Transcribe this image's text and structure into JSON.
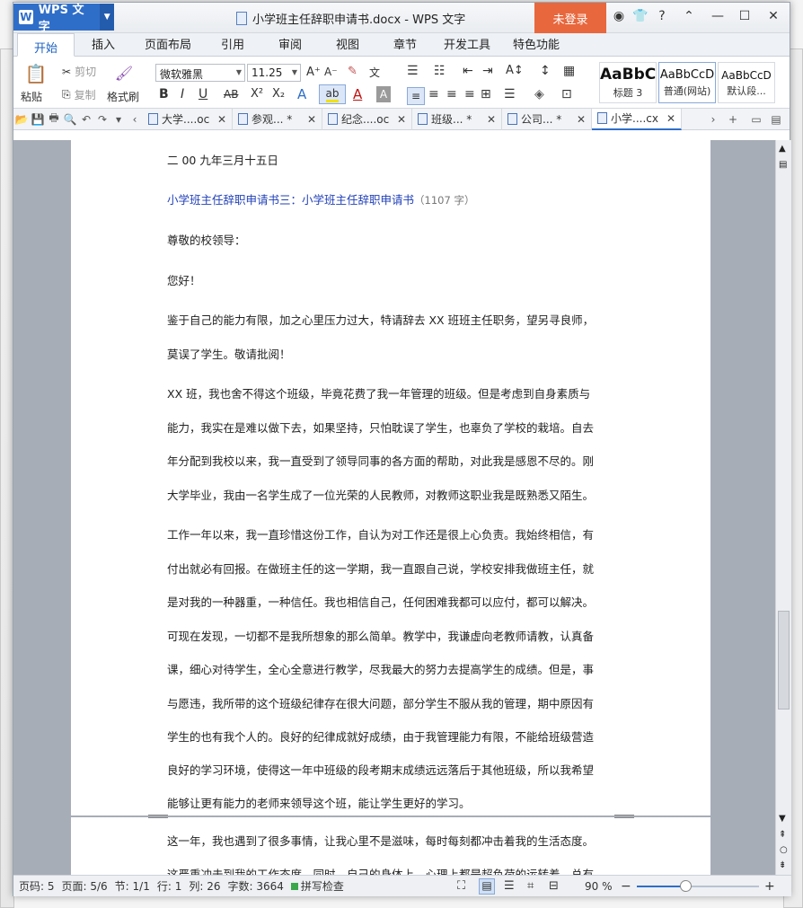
{
  "app": {
    "name": "WPS 文字",
    "title": "小学班主任辞职申请书.docx - WPS 文字",
    "login": "未登录"
  },
  "ribbon_tabs": [
    "开始",
    "插入",
    "页面布局",
    "引用",
    "审阅",
    "视图",
    "章节",
    "开发工具",
    "特色功能"
  ],
  "ribbon": {
    "paste": "粘贴",
    "cut": "剪切",
    "copy": "复制",
    "format_painter": "格式刷",
    "font_name": "微软雅黑",
    "font_size": "11.25",
    "styles": [
      {
        "preview": "AaBbC",
        "name": "标题 3"
      },
      {
        "preview": "AaBbCcD",
        "name": "普通(网站)"
      },
      {
        "preview": "AaBbCcD",
        "name": "默认段..."
      }
    ]
  },
  "doc_tabs": [
    "大学....oc",
    "参观... *",
    "纪念....oc",
    "班级... *",
    "公司... *",
    "小学....cx"
  ],
  "document": {
    "date": "二 00 九年三月十五日",
    "heading": "小学班主任辞职申请书三：小学班主任辞职申请书",
    "heading_count": "（1107 字）",
    "salutation": "尊敬的校领导：",
    "greeting": "您好！",
    "p1": [
      "鉴于自己的能力有限，加之心里压力过大，特请辞去 XX 班班主任职务，望另寻良师，",
      "莫误了学生。敬请批阅！"
    ],
    "p2": [
      "XX 班，我也舍不得这个班级，毕竟花费了我一年管理的班级。但是考虑到自身素质与",
      "能力，我实在是难以做下去，如果坚持，只怕耽误了学生，也辜负了学校的栽培。自去",
      "年分配到我校以来，我一直受到了领导同事的各方面的帮助，对此我是感恩不尽的。刚",
      "大学毕业，我由一名学生成了一位光荣的人民教师，对教师这职业我是既熟悉又陌生。"
    ],
    "p3": [
      "工作一年以来，我一直珍惜这份工作，自认为对工作还是很上心负责。我始终相信，有",
      "付出就必有回报。在做班主任的这一学期，我一直跟自己说，学校安排我做班主任，就",
      "是对我的一种器重，一种信任。我也相信自己，任何困难我都可以应付，都可以解决。",
      "可现在发现，一切都不是我所想象的那么简单。教学中，我谦虚向老教师请教，认真备",
      "课，细心对待学生，全心全意进行教学，尽我最大的努力去提高学生的成绩。但是，事",
      "与愿违，我所带的这个班级纪律存在很大问题，部分学生不服从我的管理，期中原因有",
      "学生的也有我个人的。良好的纪律成就好成绩，由于我管理能力有限，不能给班级营造",
      "良好的学习环境，使得这一年中班级的段考期末成绩远远落后于其他班级，所以我希望",
      "能够让更有能力的老师来领导这个班，能让学生更好的学习。"
    ],
    "p4": [
      "这一年，我也遇到了很多事情，让我心里不是滋味，每时每刻都冲击着我的生活态度。",
      "这严重冲击到我的工作态度。同时，自己的身体上，心理上都是超负荷的运转着，总有"
    ]
  },
  "status": {
    "page_num": "页码: 5",
    "pages": "页面: 5/6",
    "section": "节: 1/1",
    "row": "行: 1",
    "col": "列: 26",
    "words": "字数: 3664",
    "spell": "拼写检查",
    "zoom": "90 %"
  }
}
